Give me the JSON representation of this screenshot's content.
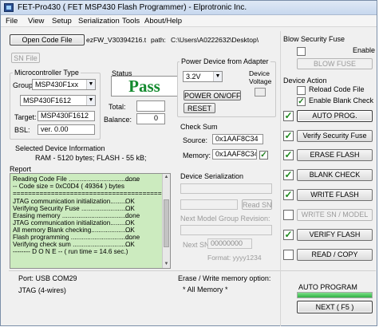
{
  "window": {
    "title": "FET-Pro430  ( FET MSP430 Flash Programmer)  -  Elprotronic Inc."
  },
  "menu": [
    "File",
    "View",
    "Setup",
    "Serialization",
    "Tools",
    "About/Help"
  ],
  "code_file": {
    "open_label": "Open Code File",
    "arrow": "→",
    "file_name": "ezFW_V30394216.t",
    "path_label": "path:",
    "path_value": "C:\\Users\\A0222632\\Desktop\\",
    "sn_file_label": "SN File"
  },
  "mcu": {
    "title": "Microcontroller Type",
    "group_label": "Group:",
    "group_value": "MSP430F1xx",
    "device_value": "MSP430F1612",
    "target_label": "Target:",
    "target_value": "MSP430F1612",
    "bsl_label": "BSL:",
    "bsl_value": "ver.   0.00"
  },
  "status": {
    "title": "Status",
    "result": "Pass",
    "total_label": "Total:",
    "total_value": "",
    "balance_label": "Balance:",
    "balance_value": "0"
  },
  "device_info": {
    "title": "Selected Device Information",
    "ram": "RAM - 5120 bytes;",
    "flash": "FLASH - 55 kB;"
  },
  "report": {
    "title": "Report",
    "lines": [
      {
        "text": "Reading Code File .......................................",
        "status": "done"
      },
      {
        "text": "-- Code size = 0xC0D4 ( 49364 ) bytes",
        "status": ""
      },
      {
        "text": "==========================================",
        "status": ""
      },
      {
        "text": "JTAG communication initialization.........",
        "status": "OK"
      },
      {
        "text": "Verifying Security Fuse ............................",
        "status": "OK"
      },
      {
        "text": "Erasing memory ......................................",
        "status": "done"
      },
      {
        "text": "JTAG communication initialization.........",
        "status": "OK"
      },
      {
        "text": "All memory Blank checking......................",
        "status": "OK"
      },
      {
        "text": "Flash programming ..................................",
        "status": "done"
      },
      {
        "text": "Verifying check sum ................................",
        "status": "OK"
      },
      {
        "text": "-------- D O N E -- ( run time =  14.6 sec.)",
        "status": ""
      }
    ]
  },
  "power": {
    "title": "Power Device from Adapter",
    "voltage_value": "3.2V",
    "device_voltage_label": "Device\nVoltage",
    "device_voltage_line1": "Device",
    "device_voltage_line2": "Voltage",
    "power_toggle_label": "POWER ON/OFF",
    "reset_label": "RESET"
  },
  "checksum": {
    "title": "Check Sum",
    "source_label": "Source:",
    "source_value": "0x1AAF8C34",
    "memory_label": "Memory:",
    "memory_value": "0x1AAF8C34"
  },
  "serialization": {
    "title": "Device Serialization",
    "read_sn_label": "Read SN",
    "next_group_label": "Next Model Group Revision:",
    "next_sn_label": "Next SN:",
    "next_sn_value": "00000000",
    "format_label": "Format: yyyy1234"
  },
  "security": {
    "title": "Blow Security Fuse",
    "enable_label": "Enable",
    "blow_label": "BLOW FUSE"
  },
  "device_action": {
    "title": "Device Action",
    "reload_label": "Reload Code File",
    "enable_blank_label": "Enable Blank Check",
    "actions": [
      {
        "label": "AUTO PROG.",
        "checked": true,
        "enabled": true
      },
      {
        "label": "Verify Security Fuse",
        "checked": true,
        "enabled": true
      },
      {
        "label": "ERASE FLASH",
        "checked": true,
        "enabled": true
      },
      {
        "label": "BLANK CHECK",
        "checked": true,
        "enabled": true
      },
      {
        "label": "WRITE FLASH",
        "checked": true,
        "enabled": true
      },
      {
        "label": "WRITE SN / MODEL",
        "checked": false,
        "enabled": false
      },
      {
        "label": "VERIFY FLASH",
        "checked": true,
        "enabled": true
      },
      {
        "label": "READ / COPY",
        "checked": false,
        "enabled": true
      }
    ]
  },
  "footer": {
    "port": "Port: USB COM29",
    "jtag": "JTAG (4-wires)",
    "erase_write_label": "Erase / Write memory option:",
    "erase_write_value": "* All Memory *",
    "auto_program_label": "AUTO PROGRAM",
    "next_label": "NEXT  ( F5 )",
    "progress_fraction": 1.0
  },
  "colors": {
    "pass_green": "#138a2e",
    "report_bg": "#ccebbf",
    "check_green": "#1d8a1d"
  },
  "icons": {
    "checkmark": "✓",
    "dropdown": "▼",
    "scroll_up": "▲",
    "scroll_down": "▼"
  }
}
